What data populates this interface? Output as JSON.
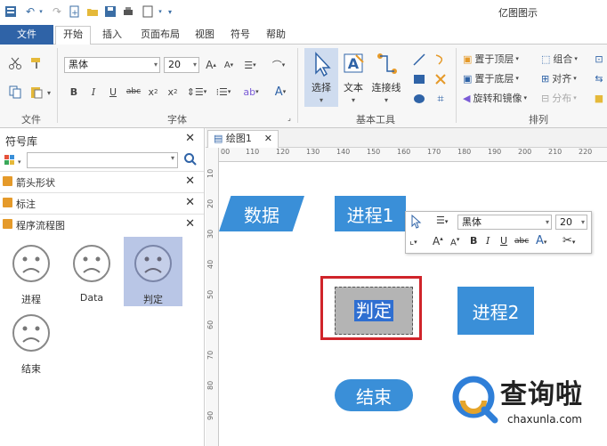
{
  "app": {
    "title": "亿图图示"
  },
  "tabs": [
    "文件",
    "开始",
    "插入",
    "页面布局",
    "视图",
    "符号",
    "帮助"
  ],
  "ribbon": {
    "font_name": "黑体",
    "font_size": "20",
    "groups": {
      "file": "文件",
      "font": "字体",
      "basic_tools": "基本工具",
      "arrange": "排列"
    },
    "tools": {
      "select": "选择",
      "text": "文本",
      "connector": "连接线"
    },
    "arrange": {
      "bring_front": "置于顶层",
      "send_back": "置于底层",
      "rotate_mirror": "旋转和镜像",
      "group": "组合",
      "align": "对齐",
      "distribute": "分布"
    }
  },
  "library": {
    "title": "符号库",
    "categories": [
      "箭头形状",
      "标注",
      "程序流程图"
    ],
    "shapes": [
      "进程",
      "Data",
      "判定",
      "结束"
    ]
  },
  "document": {
    "tab": "绘图1",
    "ruler_h": [
      "00",
      "110",
      "120",
      "130",
      "140",
      "150",
      "160",
      "170",
      "180",
      "190",
      "200",
      "210",
      "220"
    ],
    "ruler_v": [
      "10",
      "20",
      "30",
      "40",
      "50",
      "60",
      "70",
      "80",
      "90"
    ]
  },
  "canvas": {
    "data": "数据",
    "process1": "进程1",
    "decision": "判定",
    "process2": "进程2",
    "end": "结束"
  },
  "float_toolbar": {
    "font_name": "黑体",
    "font_size": "20"
  },
  "watermark": {
    "title": "查询啦",
    "url": "chaxunla.com"
  },
  "colors": {
    "shape_blue": "#3a8fd8",
    "file_tab": "#2f63a7",
    "selection_red": "#d0242a"
  }
}
